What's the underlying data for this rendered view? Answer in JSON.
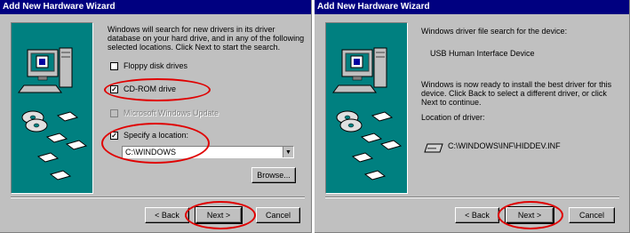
{
  "left_window": {
    "title": "Add New Hardware Wizard",
    "intro": "Windows will search for new drivers in its driver database on your hard drive, and in any of the following selected locations. Click Next to start the search.",
    "options": [
      {
        "label": "Floppy disk drives",
        "checked": false,
        "enabled": true
      },
      {
        "label": "CD-ROM drive",
        "checked": true,
        "enabled": true
      },
      {
        "label": "Microsoft Windows Update",
        "checked": false,
        "enabled": false
      },
      {
        "label": "Specify a location:",
        "checked": true,
        "enabled": true
      }
    ],
    "location_value": "C:\\WINDOWS",
    "browse_label": "Browse...",
    "back_label": "< Back",
    "next_label": "Next >",
    "cancel_label": "Cancel"
  },
  "right_window": {
    "title": "Add New Hardware Wizard",
    "search_heading": "Windows driver file search for the device:",
    "device_name": "USB Human Interface Device",
    "ready_text": "Windows is now ready to install the best driver for this device. Click Back to select a different driver, or click Next to continue.",
    "location_heading": "Location of driver:",
    "driver_path": "C:\\WINDOWS\\INF\\HIDDEV.INF",
    "back_label": "< Back",
    "next_label": "Next >",
    "cancel_label": "Cancel"
  },
  "colors": {
    "title_bar": "#000080",
    "dialog_face": "#c0c0c0",
    "art_background": "#008080",
    "highlight_ring": "#e00000"
  },
  "icons": [
    "computer-icon",
    "cd-disc-icon",
    "floppy-disk-icon",
    "drive-icon"
  ]
}
